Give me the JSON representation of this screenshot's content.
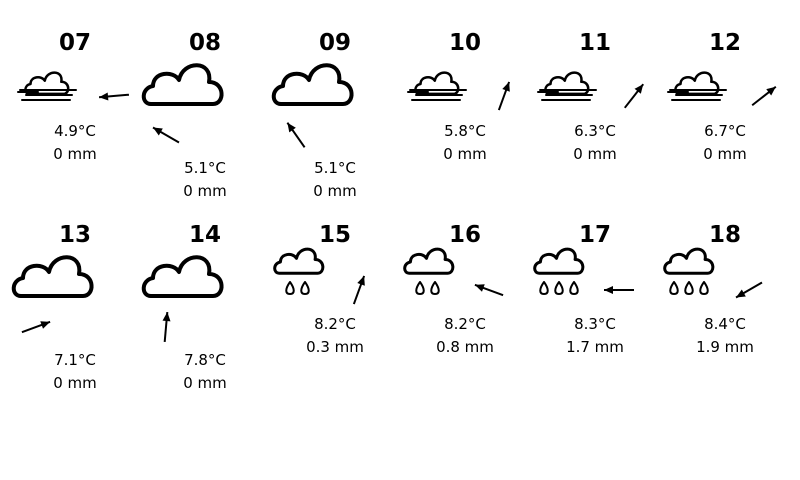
{
  "colors": {
    "background": "#ffffff",
    "foreground": "#000000"
  },
  "hours": [
    {
      "hour": "07",
      "temp": "4.9°C",
      "precip": "0 mm",
      "icon": "fog-icon",
      "wind_deg": 265,
      "drops": 0
    },
    {
      "hour": "08",
      "temp": "5.1°C",
      "precip": "0 mm",
      "icon": "cloud-icon",
      "wind_deg": 300,
      "drops": 0
    },
    {
      "hour": "09",
      "temp": "5.1°C",
      "precip": "0 mm",
      "icon": "cloud-icon",
      "wind_deg": 325,
      "drops": 0
    },
    {
      "hour": "10",
      "temp": "5.8°C",
      "precip": "0 mm",
      "icon": "fog-icon",
      "wind_deg": 20,
      "drops": 0
    },
    {
      "hour": "11",
      "temp": "6.3°C",
      "precip": "0 mm",
      "icon": "fog-icon",
      "wind_deg": 38,
      "drops": 0
    },
    {
      "hour": "12",
      "temp": "6.7°C",
      "precip": "0 mm",
      "icon": "fog-icon",
      "wind_deg": 52,
      "drops": 0
    },
    {
      "hour": "13",
      "temp": "7.1°C",
      "precip": "0 mm",
      "icon": "cloud-icon",
      "wind_deg": 70,
      "drops": 0
    },
    {
      "hour": "14",
      "temp": "7.8°C",
      "precip": "0 mm",
      "icon": "cloud-icon",
      "wind_deg": 5,
      "drops": 0
    },
    {
      "hour": "15",
      "temp": "8.2°C",
      "precip": "0.3 mm",
      "icon": "rain-cloud-icon",
      "wind_deg": 20,
      "drops": 2
    },
    {
      "hour": "16",
      "temp": "8.2°C",
      "precip": "0.8 mm",
      "icon": "rain-cloud-icon",
      "wind_deg": 290,
      "drops": 2
    },
    {
      "hour": "17",
      "temp": "8.3°C",
      "precip": "1.7 mm",
      "icon": "rain-cloud-icon",
      "wind_deg": 270,
      "drops": 3
    },
    {
      "hour": "18",
      "temp": "8.4°C",
      "precip": "1.9 mm",
      "icon": "rain-cloud-icon",
      "wind_deg": 240,
      "drops": 3
    }
  ]
}
